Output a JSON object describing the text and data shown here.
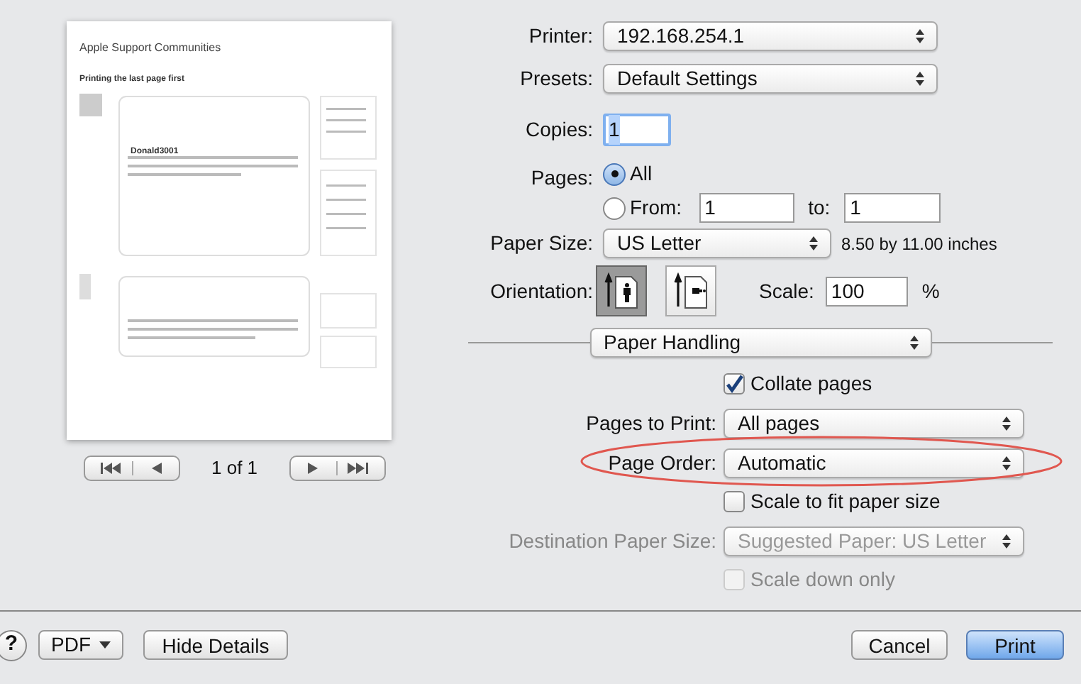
{
  "preview": {
    "site_title": "Apple Support Communities",
    "thread_title": "Printing the last page first",
    "author": "Donald3001",
    "page_count": "1 of 1"
  },
  "printer": {
    "label": "Printer:",
    "value": "192.168.254.1"
  },
  "presets": {
    "label": "Presets:",
    "value": "Default Settings"
  },
  "copies": {
    "label": "Copies:",
    "value": "1"
  },
  "pages": {
    "label": "Pages:",
    "options": [
      {
        "label": "All",
        "selected": true
      },
      {
        "label": "From:",
        "selected": false
      }
    ],
    "from": "1",
    "to_label": "to:",
    "to": "1"
  },
  "paper_size": {
    "label": "Paper Size:",
    "value": "US Letter",
    "note": "8.50 by 11.00 inches"
  },
  "orientation": {
    "label": "Orientation:",
    "options": [
      {
        "kind": "portrait",
        "selected": true
      },
      {
        "kind": "landscape",
        "selected": false
      }
    ]
  },
  "scale": {
    "label": "Scale:",
    "value": "100",
    "unit": "%"
  },
  "section": {
    "value": "Paper Handling"
  },
  "paper_handling": [
    {
      "kind": "checkbox",
      "label": "Collate pages",
      "checked": true,
      "disabled": false
    },
    {
      "kind": "popup",
      "label": "Pages to Print:",
      "value": "All pages",
      "disabled": false
    },
    {
      "kind": "popup",
      "label": "Page Order:",
      "value": "Automatic",
      "disabled": false
    },
    {
      "kind": "checkbox",
      "label": "Scale to fit paper size",
      "checked": false,
      "disabled": false
    },
    {
      "kind": "popup",
      "label": "Destination Paper Size:",
      "value": "Suggested Paper: US Letter",
      "disabled": true
    },
    {
      "kind": "checkbox",
      "label": "Scale down only",
      "checked": false,
      "disabled": true
    }
  ],
  "buttons": {
    "help": "?",
    "pdf": "PDF",
    "details": "Hide Details",
    "cancel": "Cancel",
    "print": "Print"
  }
}
